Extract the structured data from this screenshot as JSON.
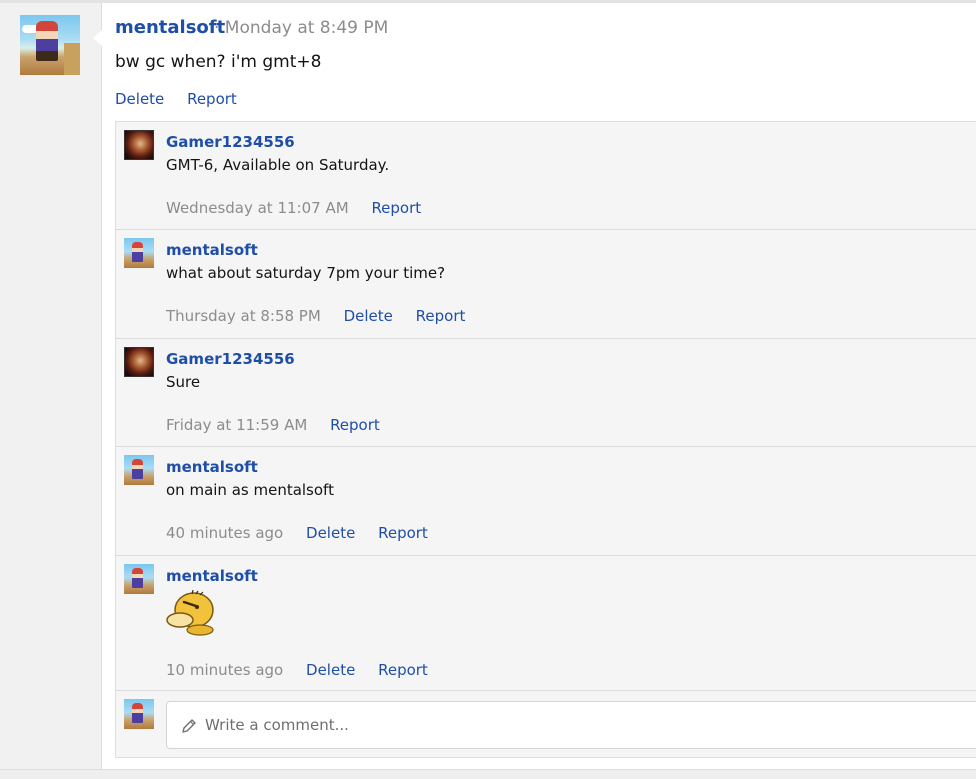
{
  "post": {
    "author": "mentalsoft",
    "time": "· Monday at 8:49 PM",
    "body": "bw gc when? i'm gmt+8",
    "actions": {
      "delete": "Delete",
      "report": "Report"
    }
  },
  "comments": [
    {
      "author": "Gamer1234556",
      "text": "GMT-6, Available on Saturday.",
      "time": "Wednesday at 11:07 AM",
      "report": "Report"
    },
    {
      "author": "mentalsoft",
      "text": "what about saturday 7pm your time?",
      "time": "Thursday at 8:58 PM",
      "delete": "Delete",
      "report": "Report"
    },
    {
      "author": "Gamer1234556",
      "text": "Sure",
      "time": "Friday at 11:59 AM",
      "report": "Report"
    },
    {
      "author": "mentalsoft",
      "text": "on main as mentalsoft",
      "time": "40 minutes ago",
      "delete": "Delete",
      "report": "Report"
    },
    {
      "author": "mentalsoft",
      "image": "psyduck-emoji",
      "time": "10 minutes ago",
      "delete": "Delete",
      "report": "Report"
    }
  ],
  "composer": {
    "placeholder": "Write a comment...",
    "icon": "pencil-icon"
  },
  "colors": {
    "link": "#1f4ea8",
    "muted": "#8c8c8c",
    "comment_bg": "#f5f5f5"
  }
}
